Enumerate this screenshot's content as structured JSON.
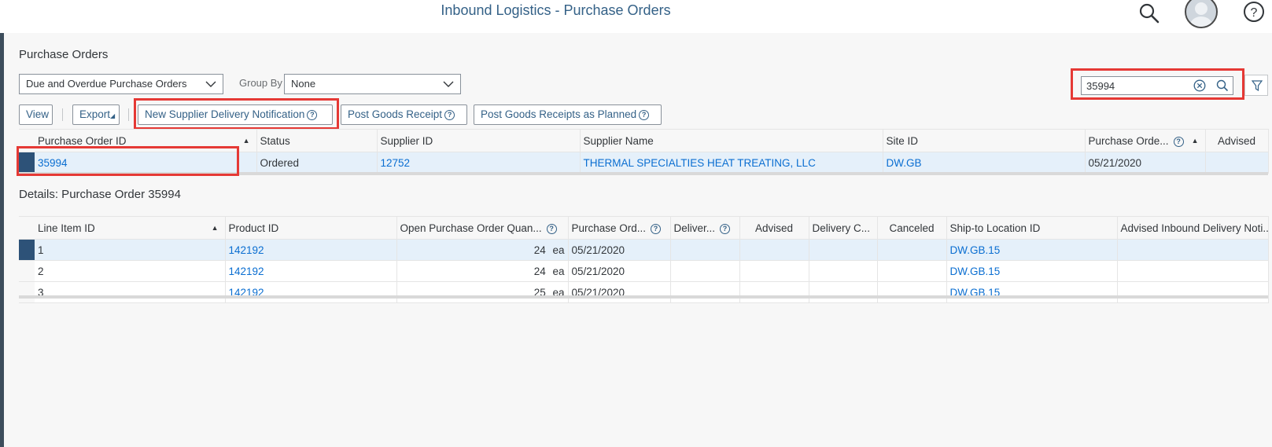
{
  "shell": {
    "title": "Inbound Logistics - Purchase Orders",
    "icons": [
      "search-icon",
      "avatar",
      "help-icon"
    ]
  },
  "page": {
    "title": "Purchase Orders",
    "view_select": "Due and Overdue Purchase Orders",
    "group_by_label": "Group By",
    "group_by_value": "None",
    "search_value": "35994"
  },
  "toolbar": {
    "view": "View",
    "export": "Export",
    "new_sdn": "New Supplier Delivery Notification",
    "post_gr": "Post Goods Receipt",
    "post_gr_planned": "Post Goods Receipts as Planned"
  },
  "po_table": {
    "columns": [
      "Purchase Order ID",
      "Status",
      "Supplier ID",
      "Supplier Name",
      "Site ID",
      "Purchase Orde...",
      "Advised"
    ],
    "rows": [
      {
        "po_id": "35994",
        "status": "Ordered",
        "supplier_id": "12752",
        "supplier_name": "THERMAL SPECIALTIES HEAT TREATING, LLC",
        "site_id": "DW.GB",
        "date": "05/21/2020",
        "advised": ""
      }
    ]
  },
  "details": {
    "title": "Details: Purchase Order 35994",
    "columns": [
      "Line Item ID",
      "Product ID",
      "Open Purchase Order Quan...",
      "Purchase Ord...",
      "Deliver...",
      "Advised",
      "Delivery C...",
      "Canceled",
      "Ship-to Location ID",
      "Advised Inbound Delivery Noti..."
    ],
    "rows": [
      {
        "line": "1",
        "product": "142192",
        "qty": "24",
        "unit": "ea",
        "date": "05/21/2020",
        "ship_to": "DW.GB.15"
      },
      {
        "line": "2",
        "product": "142192",
        "qty": "24",
        "unit": "ea",
        "date": "05/21/2020",
        "ship_to": "DW.GB.15"
      },
      {
        "line": "3",
        "product": "142192",
        "qty": "25",
        "unit": "ea",
        "date": "05/21/2020",
        "ship_to": "DW.GB.15"
      }
    ]
  },
  "colors": {
    "accent": "#346187",
    "link": "#0a6ed1",
    "highlight": "#e53935",
    "selection": "#2d5278"
  }
}
